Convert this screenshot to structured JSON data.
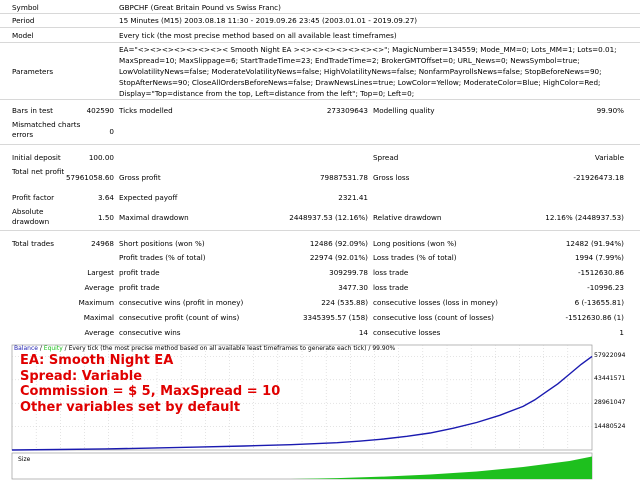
{
  "header": {
    "symbol_label": "Symbol",
    "symbol_value": "GBPCHF (Great Britain Pound vs Swiss Franc)",
    "period_label": "Period",
    "period_value": "15 Minutes (M15) 2003.08.18 11:30 - 2019.09.26 23:45 (2003.01.01 - 2019.09.27)",
    "model_label": "Model",
    "model_value": "Every tick (the most precise method based on all available least timeframes)",
    "parameters_label": "Parameters",
    "parameters_value": "EA=\"<><><><><><><>< Smooth Night EA ><><><><><><><>\"; MagicNumber=134559; Mode_MM=0; Lots_MM=1; Lots=0.01; MaxSpread=10; MaxSlippage=6; StartTradeTime=23; EndTradeTime=2; BrokerGMTOffset=0; URL_News=0; NewsSymbol=true; LowVolatilityNews=false; ModerateVolatilityNews=false; HighVolatilityNews=false; NonfarmPayrollsNews=false; StopBeforeNews=90; StopAfterNews=90; CloseAllOrdersBeforeNews=false; DrawNewsLines=true; LowColor=Yellow; ModerateColor=Blue; HighColor=Red; Display=\"Top=distance from the top, Left=distance from the left\"; Top=0; Left=0;"
  },
  "stats": {
    "bars_label": "Bars in test",
    "bars_value": "402590",
    "ticks_label": "Ticks modelled",
    "ticks_value": "273309643",
    "quality_label": "Modelling quality",
    "quality_value": "99.90%",
    "mismatch_label": "Mismatched charts errors",
    "mismatch_value": "0",
    "deposit_label": "Initial deposit",
    "deposit_value": "100.00",
    "spread_label": "Spread",
    "spread_value": "Variable",
    "netprofit_label": "Total net profit",
    "netprofit_value": "57961058.60",
    "grossprofit_label": "Gross profit",
    "grossprofit_value": "79887531.78",
    "grossloss_label": "Gross loss",
    "grossloss_value": "-21926473.18",
    "pf_label": "Profit factor",
    "pf_value": "3.64",
    "payoff_label": "Expected payoff",
    "payoff_value": "2321.41",
    "absdd_label": "Absolute drawdown",
    "absdd_value": "1.50",
    "maxdd_label": "Maximal drawdown",
    "maxdd_value": "2448937.53 (12.16%)",
    "reldd_label": "Relative drawdown",
    "reldd_value": "12.16% (2448937.53)",
    "trades_label": "Total trades",
    "trades_value": "24968",
    "short_label": "Short positions (won %)",
    "short_value": "12486 (92.09%)",
    "long_label": "Long positions (won %)",
    "long_value": "12482 (91.94%)",
    "ptrades_label": "Profit trades (% of total)",
    "ptrades_value": "22974 (92.01%)",
    "ltrades_label": "Loss trades (% of total)",
    "ltrades_value": "1994 (7.99%)",
    "largest_label": "Largest",
    "lp_label": "profit trade",
    "lp_value": "309299.78",
    "ll_label": "loss trade",
    "ll_value": "-1512630.86",
    "average_label": "Average",
    "ap_label": "profit trade",
    "ap_value": "3477.30",
    "al_label": "loss trade",
    "al_value": "-10996.23",
    "maximum_label": "Maximum",
    "mcw_label": "consecutive wins (profit in money)",
    "mcw_value": "224 (535.88)",
    "mcl_label": "consecutive losses (loss in money)",
    "mcl_value": "6 (-13655.81)",
    "maximal_label": "Maximal",
    "mcp_label": "consecutive profit (count of wins)",
    "mcp_value": "3345395.57 (158)",
    "mclo_label": "consecutive loss (count of losses)",
    "mclo_value": "-1512630.86 (1)",
    "average2_label": "Average",
    "acw_label": "consecutive wins",
    "acw_value": "14",
    "acl_label": "consecutive losses",
    "acl_value": "1"
  },
  "chart": {
    "legend_balance": "Balance",
    "legend_sep": " / ",
    "legend_equity": "Equity",
    "legend_rest": " / Every tick (the most precise method based on all available least timeframes to generate each tick) / 99.90%",
    "size_label": "Size",
    "overlay": {
      "line1": "EA: Smooth Night EA",
      "line2": "Spread: Variable",
      "line3": "Commission = $ 5, MaxSpread = 10",
      "line4": "Other variables set by default"
    },
    "colors": {
      "balance": "#1a1ab0",
      "equity": "#1ec01e",
      "overlay": "#e00000",
      "grid": "#c8c8c8"
    }
  },
  "chart_data": {
    "type": "line",
    "title": "",
    "xlabel": "",
    "ylabel": "",
    "yticks": [
      "57922094",
      "43441571",
      "28961047",
      "14480524"
    ],
    "ylim": [
      0,
      65000000
    ],
    "grid": true,
    "series": [
      {
        "name": "Balance",
        "x": [
          0,
          2000,
          4000,
          6000,
          8000,
          10000,
          12000,
          14000,
          15000,
          16000,
          17000,
          18000,
          19000,
          20000,
          21000,
          22000,
          22500,
          23000,
          23500,
          24000,
          24500,
          24968
        ],
        "values": [
          100,
          300000,
          700000,
          1200000,
          1800000,
          2500000,
          3300000,
          4500000,
          5500000,
          6800000,
          8500000,
          10500000,
          13500000,
          17000000,
          21500000,
          27000000,
          31000000,
          36000000,
          41000000,
          47000000,
          53000000,
          57961058
        ]
      }
    ],
    "size_series": {
      "x": [
        0,
        12000,
        14000,
        16000,
        18000,
        20000,
        22000,
        24000,
        24968
      ],
      "values": [
        0,
        0,
        0.3,
        0.8,
        1.5,
        2.5,
        4.0,
        6.0,
        7.5
      ]
    }
  }
}
